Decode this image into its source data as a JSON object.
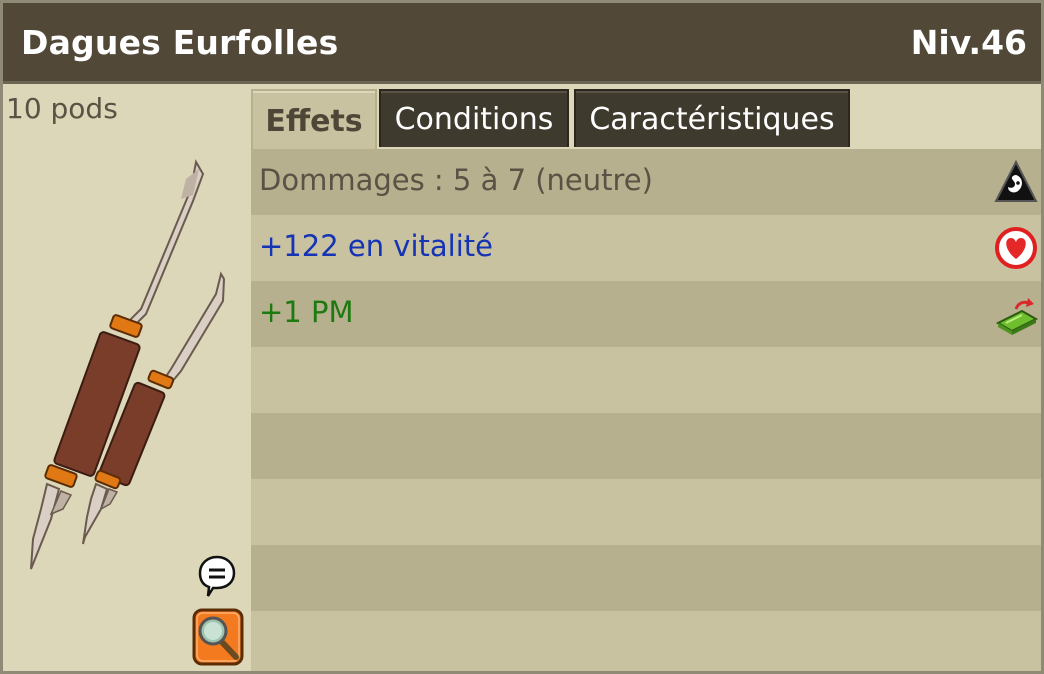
{
  "item": {
    "name": "Dagues Eurfolles",
    "level": "Niv.46",
    "weight": "10 pods"
  },
  "tabs": [
    {
      "label": "Effets",
      "active": true
    },
    {
      "label": "Conditions",
      "active": false
    },
    {
      "label": "Caractéristiques",
      "active": false
    }
  ],
  "effects": [
    {
      "text": "Dommages : 5 à 7 (neutre)",
      "color": "#5a5244",
      "icon": "neutral-element-icon"
    },
    {
      "text": "+122 en vitalité",
      "color": "#1433b5",
      "icon": "vitality-heart-icon"
    },
    {
      "text": "+1 PM",
      "color": "#1e7a10",
      "icon": "movement-points-icon"
    }
  ],
  "icons": {
    "chat": "chat-bubble-icon",
    "zoom": "magnifier-icon"
  }
}
